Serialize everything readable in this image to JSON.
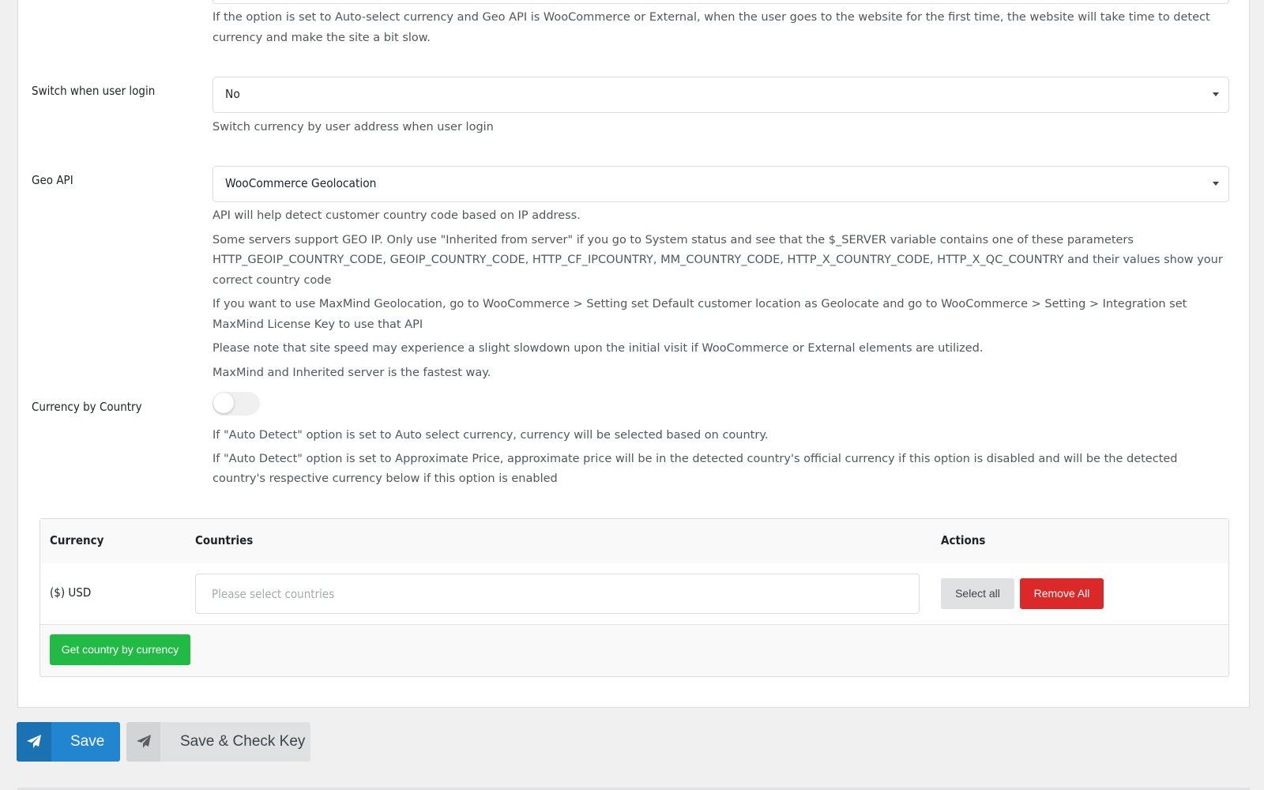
{
  "autodetect": {
    "description": "If the option is set to Auto-select currency and Geo API is WooCommerce or External, when the user goes to the website for the first time, the website will take time to detect currency and make the site a bit slow."
  },
  "switch_login": {
    "label": "Switch when user login",
    "value": "No",
    "description": "Switch currency by user address when user login"
  },
  "geo_api": {
    "label": "Geo API",
    "value": "WooCommerce Geolocation",
    "descriptions": [
      "API will help detect customer country code based on IP address.",
      "Some servers support GEO IP. Only use \"Inherited from server\" if you go to System status and see that the $_SERVER variable contains one of these parameters HTTP_GEOIP_COUNTRY_CODE, GEOIP_COUNTRY_CODE, HTTP_CF_IPCOUNTRY, MM_COUNTRY_CODE, HTTP_X_COUNTRY_CODE, HTTP_X_QC_COUNTRY and their values show your correct country code",
      "If you want to use MaxMind Geolocation, go to WooCommerce > Setting set Default customer location as Geolocate and go to WooCommerce > Setting > Integration set MaxMind License Key to use that API",
      "Please note that site speed may experience a slight slowdown upon the initial visit if WooCommerce or External elements are utilized.",
      "MaxMind and Inherited server is the fastest way."
    ]
  },
  "currency_by_country": {
    "label": "Currency by Country",
    "enabled": false,
    "descriptions": [
      "If \"Auto Detect\" option is set to Auto select currency, currency will be selected based on country.",
      "If \"Auto Detect\" option is set to Approximate Price, approximate price will be in the detected country's official currency if this option is disabled and will be the detected country's respective currency below if this option is enabled"
    ]
  },
  "table": {
    "headers": {
      "currency": "Currency",
      "countries": "Countries",
      "actions": "Actions"
    },
    "rows": [
      {
        "currency": "($) USD",
        "countries_placeholder": "Please select countries",
        "select_all": "Select all",
        "remove_all": "Remove All"
      }
    ],
    "get_country_button": "Get country by currency"
  },
  "footer": {
    "save": "Save",
    "save_check": "Save & Check Key",
    "save_icon": "paper-plane-icon",
    "save_check_icon": "paper-plane-icon"
  },
  "colors": {
    "primary": "#2185d0",
    "danger": "#db2828",
    "success": "#21ba45",
    "secondary": "#e0e1e2"
  }
}
